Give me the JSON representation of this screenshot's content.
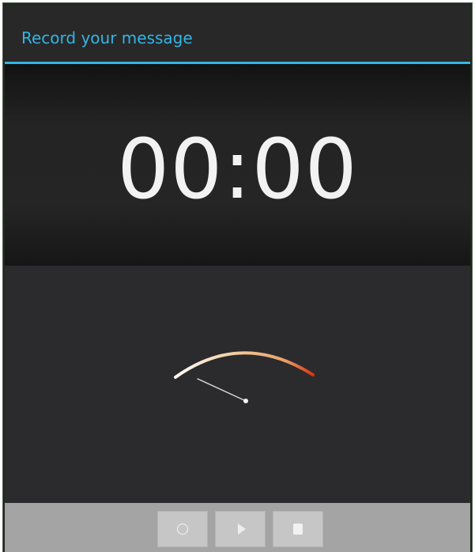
{
  "dialog": {
    "title": "Record your message"
  },
  "recorder": {
    "elapsed_time": "00:00",
    "level": 0
  },
  "controls": [
    {
      "id": "record",
      "icon": "record-icon"
    },
    {
      "id": "play",
      "icon": "play-icon"
    },
    {
      "id": "stop",
      "icon": "stop-icon"
    }
  ],
  "colors": {
    "accent": "#33b5e5",
    "dialog_background": "#2a2a2a",
    "timer_text": "#f2f2f2",
    "control_bar": "#a4a4a4",
    "button": "#c6c6c6",
    "meter_low": "#fffdf6",
    "meter_mid": "#f0c493",
    "meter_high": "#d8340c"
  }
}
